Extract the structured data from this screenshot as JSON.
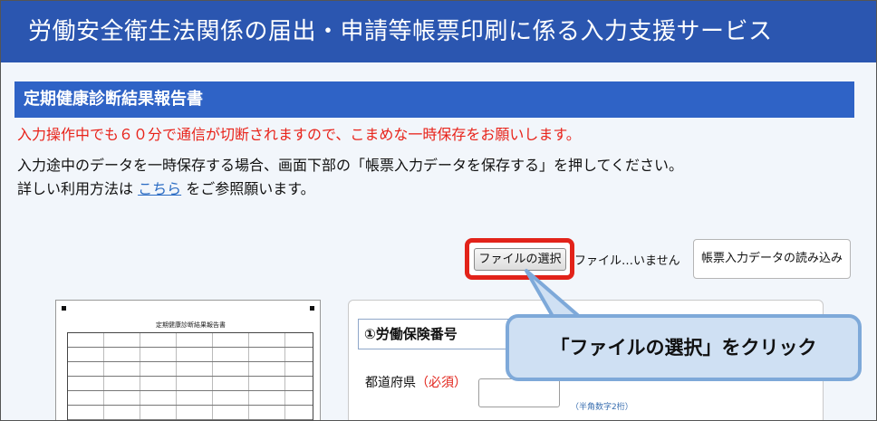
{
  "header": {
    "title": "労働安全衛生法関係の届出・申請等帳票印刷に係る入力支援サービス"
  },
  "section": {
    "title": "定期健康診断結果報告書"
  },
  "notices": {
    "warning": "入力操作中でも６０分で通信が切断されますので、こまめな一時保存をお願いします。",
    "info1": "入力途中のデータを一時保存する場合、画面下部の「帳票入力データを保存する」を押してください。",
    "info2_prefix": "詳しい利用方法は",
    "info2_link": "こちら",
    "info2_suffix": "をご参照願います。"
  },
  "file_input": {
    "button_label": "ファイルの選択",
    "status": "ファイル…いません"
  },
  "load_button": {
    "label": "帳票入力データの読み込み"
  },
  "preview": {
    "doc_title": "定期健康診断結果報告書"
  },
  "form": {
    "insurance_field": "①労働保険番号",
    "prefecture_label": "都道府県",
    "prefecture_required": "（必須）",
    "prefecture_hint": "（半角数字2桁）"
  },
  "callout": {
    "text": "「ファイルの選択」をクリック"
  },
  "colors": {
    "header_bg": "#2b56b0",
    "section_bg": "#2f63c6",
    "warning": "#e8231a",
    "highlight": "#e2231a",
    "callout_bg": "#cfe0f3"
  }
}
